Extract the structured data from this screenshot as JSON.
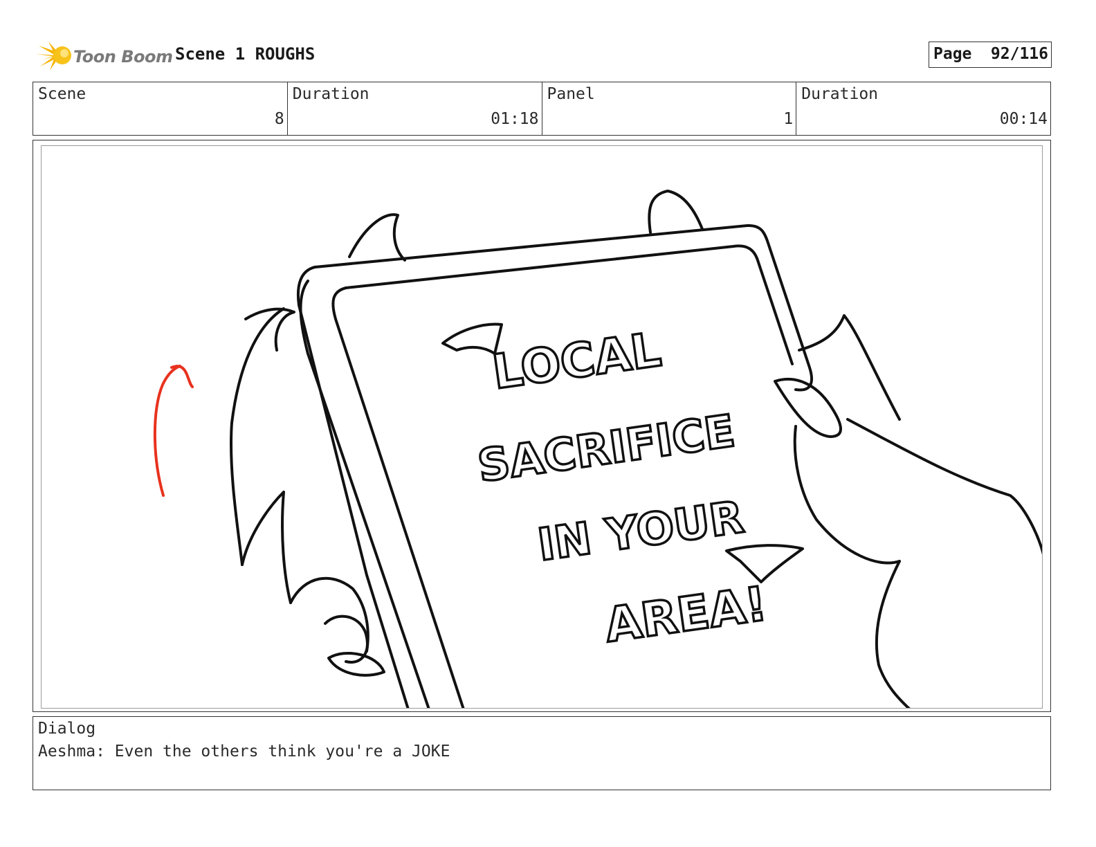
{
  "header": {
    "logo_text": "Toon Boom",
    "scene_title": "Scene 1 ROUGHS",
    "page_label": "Page",
    "page_number": "92/116"
  },
  "info": [
    {
      "label": "Scene",
      "value": "8"
    },
    {
      "label": "Duration",
      "value": "01:18"
    },
    {
      "label": "Panel",
      "value": "1"
    },
    {
      "label": "Duration",
      "value": "00:14"
    }
  ],
  "panel": {
    "sign_lines": [
      "LOCAL",
      "SACRIFICE",
      "IN YOUR",
      "AREA!"
    ],
    "arrow_color": "#e8321e"
  },
  "dialog": {
    "label": "Dialog",
    "text": "Aeshma: Even the others think you're a JOKE"
  },
  "colors": {
    "logo_flare": "#f5b400",
    "border": "#333333"
  }
}
